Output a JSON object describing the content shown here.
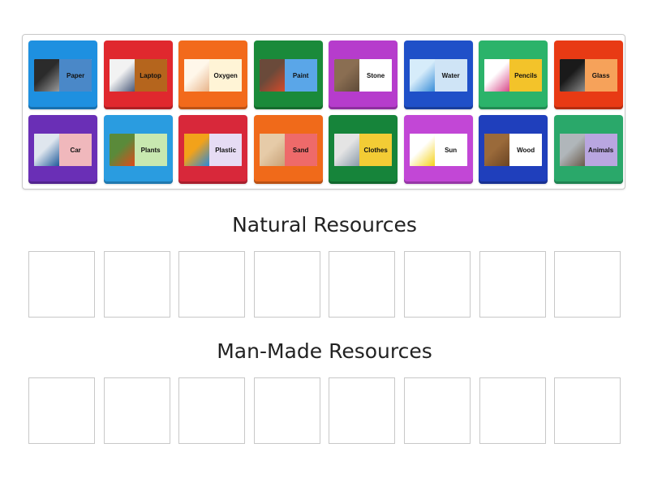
{
  "tiles": [
    {
      "label": "Paper",
      "tile_color": "#1e90e0",
      "label_bg": "#4a88c8",
      "picture": "paper-stack-icon",
      "pic_colors": [
        "#2b2b2b",
        "#9a9a9a"
      ]
    },
    {
      "label": "Laptop",
      "tile_color": "#e0282e",
      "label_bg": "#b5651d",
      "picture": "laptop-icon",
      "pic_colors": [
        "#f2f2f2",
        "#4a5a7a"
      ]
    },
    {
      "label": "Oxygen",
      "tile_color": "#f26a1b",
      "label_bg": "#fff4d6",
      "picture": "breathing-icon",
      "pic_colors": [
        "#fff7ea",
        "#e8b48a"
      ]
    },
    {
      "label": "Paint",
      "tile_color": "#1a8a3a",
      "label_bg": "#5aa6e8",
      "picture": "paint-palette-icon",
      "pic_colors": [
        "#6a4a3a",
        "#d44a2a"
      ]
    },
    {
      "label": "Stone",
      "tile_color": "#b63ccc",
      "label_bg": "#ffffff",
      "picture": "stone-icon",
      "pic_colors": [
        "#8a6e52",
        "#5e4a38"
      ]
    },
    {
      "label": "Water",
      "tile_color": "#1f50c8",
      "label_bg": "#cfe4f6",
      "picture": "water-icon",
      "pic_colors": [
        "#d6ecfa",
        "#3a8ed8"
      ]
    },
    {
      "label": "Pencils",
      "tile_color": "#2bb36a",
      "label_bg": "#f3c32a",
      "picture": "pencils-icon",
      "pic_colors": [
        "#ffffff",
        "#d84a8a"
      ]
    },
    {
      "label": "Glass",
      "tile_color": "#e83a14",
      "label_bg": "#f6a25a",
      "picture": "glass-icon",
      "pic_colors": [
        "#1a1a1a",
        "#8a8a8a"
      ]
    },
    {
      "label": "Car",
      "tile_color": "#6a2fb6",
      "label_bg": "#f0b8bc",
      "picture": "car-icon",
      "pic_colors": [
        "#dfe6ee",
        "#1f5a9a"
      ]
    },
    {
      "label": "Plants",
      "tile_color": "#2a9ce0",
      "label_bg": "#c8e8b0",
      "picture": "tomato-plant-icon",
      "pic_colors": [
        "#5a8a3a",
        "#e04a1a"
      ]
    },
    {
      "label": "Plastic",
      "tile_color": "#d8283a",
      "label_bg": "#e6dcf4",
      "picture": "plastic-toys-icon",
      "pic_colors": [
        "#f2a21a",
        "#2a8ad8"
      ]
    },
    {
      "label": "Sand",
      "tile_color": "#f06a1a",
      "label_bg": "#ee6a6a",
      "picture": "sand-icon",
      "pic_colors": [
        "#e6cba8",
        "#c8a278"
      ]
    },
    {
      "label": "Clothes",
      "tile_color": "#16843a",
      "label_bg": "#f3cc35",
      "picture": "clothes-icon",
      "pic_colors": [
        "#e4e4e4",
        "#8a9aaa"
      ]
    },
    {
      "label": "Sun",
      "tile_color": "#c247d6",
      "label_bg": "#ffffff",
      "picture": "sun-icon",
      "pic_colors": [
        "#ffffff",
        "#f5d21a"
      ]
    },
    {
      "label": "Wood",
      "tile_color": "#1f3fbc",
      "label_bg": "#ffffff",
      "picture": "wood-icon",
      "pic_colors": [
        "#9a6a3a",
        "#6a4424"
      ]
    },
    {
      "label": "Animals",
      "tile_color": "#2aa86a",
      "label_bg": "#b9a6e0",
      "picture": "animals-icon",
      "pic_colors": [
        "#b0b6ba",
        "#6a5a4a"
      ]
    }
  ],
  "groups": [
    {
      "title": "Natural Resources",
      "slot_count": 8
    },
    {
      "title": "Man-Made Resources",
      "slot_count": 8
    }
  ]
}
